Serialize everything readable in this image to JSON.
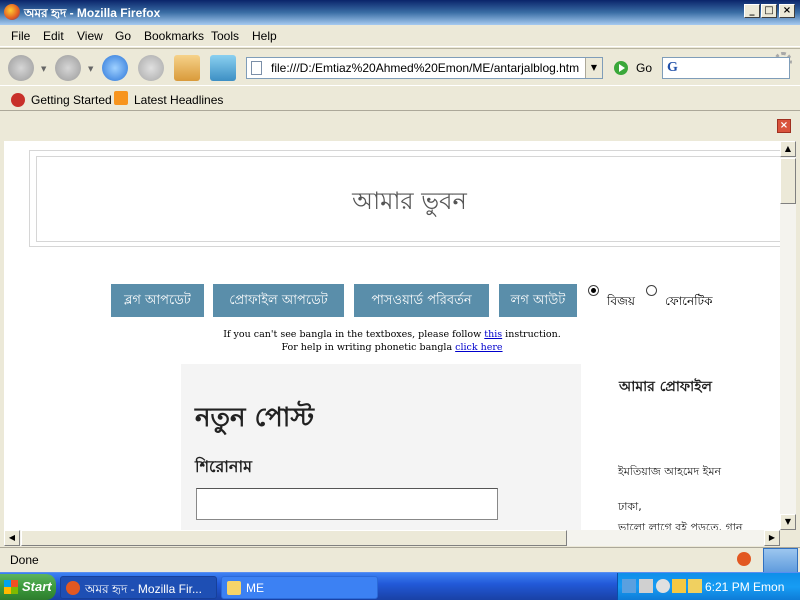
{
  "window": {
    "title": "অমর হৃদ - Mozilla Firefox",
    "controls": {
      "minimize": "_",
      "maximize": "□",
      "close": "×"
    }
  },
  "menu": [
    "File",
    "Edit",
    "View",
    "Go",
    "Bookmarks",
    "Tools",
    "Help"
  ],
  "toolbar": {
    "url": "file:///D:/Emtiaz%20Ahmed%20Emon/ME/antarjalblog.htm",
    "go_label": "Go",
    "search_engine_glyph": "G"
  },
  "bookmarks": [
    {
      "label": "Getting Started",
      "icon": "firefox-icon"
    },
    {
      "label": "Latest Headlines",
      "icon": "rss-icon"
    }
  ],
  "page": {
    "banner_title": "আমার ভুবন",
    "nav_buttons": [
      "ব্লগ আপডেট",
      "প্রোফাইল আপডেট",
      "পাসওয়ার্ড পরিবর্তন",
      "লগ আউট"
    ],
    "keyboard_options": [
      {
        "label": "বিজয়",
        "checked": true
      },
      {
        "label": "ফোনেটিক",
        "checked": false
      }
    ],
    "info_line1_before": "If you can't see bangla in the textboxes, please follow ",
    "info_line1_link": "this",
    "info_line1_after": " instruction.",
    "info_line2_before": "For help in writing phonetic bangla ",
    "info_line2_link": "click here",
    "new_post_heading": "নতুন পোস্ট",
    "title_label": "শিরোনাম",
    "title_input_value": "",
    "profile": {
      "heading": "আমার প্রোফাইল",
      "name": "ইমতিয়াজ আহমেদ ইমন",
      "city": "ঢাকা,",
      "line3": "ভালো লাগে বই পড়তে, গান"
    }
  },
  "status": {
    "text": "Done"
  },
  "taskbar": {
    "start_label": "Start",
    "tasks": [
      {
        "label": "অমর হৃদ - Mozilla Fir...",
        "active": true
      },
      {
        "label": "ME",
        "active": false
      }
    ],
    "clock": "6:21 PM Emon"
  }
}
